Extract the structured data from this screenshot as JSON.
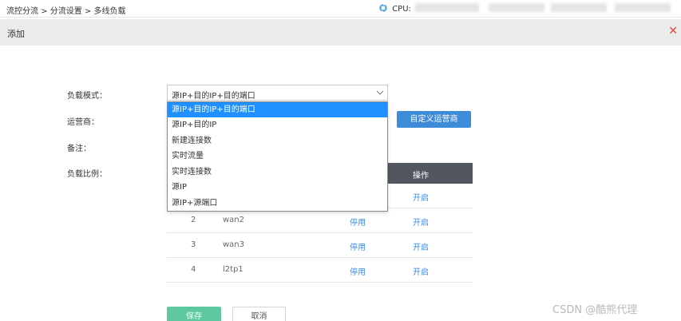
{
  "breadcrumb": "流控分流 > 分流设置 > 多线负载",
  "cpu_label": "CPU:",
  "dialog": {
    "title": "添加",
    "close_icon": "close-icon"
  },
  "form": {
    "mode_label": "负载模式：",
    "mode_value": "源IP+目的IP+目的端口",
    "carrier_label": "运营商：",
    "custom_carrier_button": "自定义运营商",
    "note_label": "备注：",
    "ratio_label": "负载比例："
  },
  "dropdown_options": [
    "源IP+目的IP+目的端口",
    "源IP+目的IP",
    "新建连接数",
    "实时流量",
    "实时连接数",
    "源IP",
    "源IP+源端口"
  ],
  "table": {
    "op_header": "操作",
    "rows": [
      {
        "num": "",
        "name": "",
        "stop": "",
        "open": "开启"
      },
      {
        "num": "2",
        "name": "wan2",
        "stop": "停用",
        "open": "开启"
      },
      {
        "num": "3",
        "name": "wan3",
        "stop": "停用",
        "open": "开启"
      },
      {
        "num": "4",
        "name": "l2tp1",
        "stop": "停用",
        "open": "开启"
      }
    ]
  },
  "buttons": {
    "save": "保存",
    "cancel": "取消"
  },
  "watermark": "CSDN @酷熊代理",
  "colors": {
    "accent_blue": "#3e8bd8",
    "link_blue": "#3a8ee6",
    "save_green": "#5ec8a0",
    "header_dark": "#52575f",
    "close_red": "#e2453b"
  }
}
